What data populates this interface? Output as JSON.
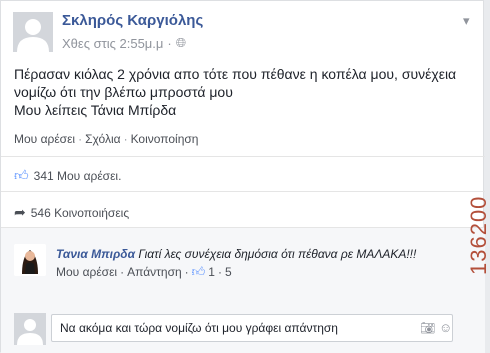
{
  "post": {
    "author": "Σκληρός Καργιόλης",
    "timestamp": "Χθες στις 2:55μ.μ",
    "audience_icon": "globe-icon",
    "text_line1": "Πέρασαν κιόλας 2 χρόνια απο τότε που πέθανε η κοπέλα μου, συνέχεια",
    "text_line2": "νομίζω ότι την βλέπω μπροστά μου",
    "text_line3": "Μου λείπεις Τάνια Μπίρδα",
    "actions": {
      "like": "Μου αρέσει",
      "comment": "Σχόλια",
      "share": "Κοινοποίηση",
      "sep": "·"
    },
    "likes": "341 Μου αρέσει.",
    "shares": "546 Κοινοποιήσεις"
  },
  "comment": {
    "name": "Τανια Μπιρδα",
    "text": "Γιατί λες συνέχεια δημόσια ότι πέθανα ρε ΜΑΛΑΚΑ!!!",
    "like": "Μου αρέσει",
    "reply": "Απάντηση",
    "likes_count": "1",
    "time": "5",
    "sep": "·"
  },
  "reply_input": {
    "value": "Να ακόμα και τώρα νομίζω ότι μου γράφει απάντηση"
  },
  "watermark": "136200",
  "colors": {
    "link": "#3b5998",
    "like_icon": "#5890ff",
    "watermark": "#b34f3a"
  }
}
